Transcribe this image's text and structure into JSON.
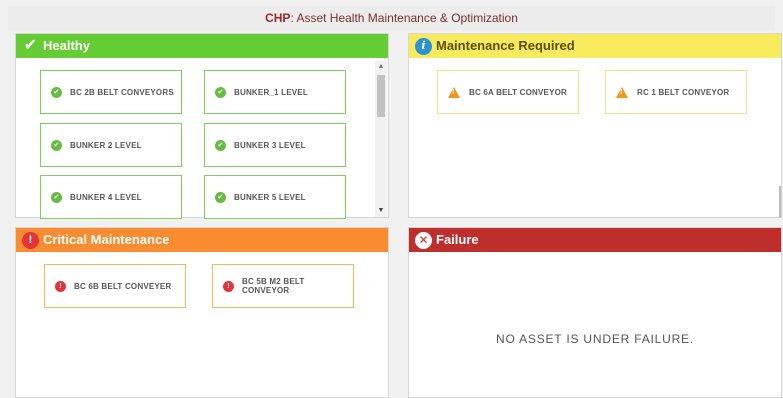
{
  "title": {
    "brand": "CHP",
    "text": ": Asset Health Maintenance & Optimization"
  },
  "panels": {
    "healthy": {
      "label": "Healthy",
      "color": "#66cc33",
      "assets": [
        "BC 2B BELT CONVEYORS",
        "BUNKER_1 LEVEL",
        "BUNKER 2 LEVEL",
        "BUNKER 3 LEVEL",
        "BUNKER 4 LEVEL",
        "BUNKER 5 LEVEL"
      ]
    },
    "maintenance": {
      "label": "Maintenance Required",
      "color": "#f7ea5c",
      "assets": [
        "BC 6A BELT CONVEYOR",
        "RC 1 BELT CONVEYOR"
      ]
    },
    "critical": {
      "label": "Critical Maintenance",
      "color": "#f98c31",
      "assets": [
        "BC 6B BELT CONVEYER",
        "BC 5B M2 BELT CONVEYOR"
      ]
    },
    "failure": {
      "label": "Failure",
      "color": "#bf2e2b",
      "empty_message": "NO ASSET IS UNDER FAILURE."
    }
  },
  "icons": {
    "healthy": "check-circle-icon",
    "maintenance": "info-circle-icon",
    "critical": "exclamation-circle-icon",
    "failure": "x-circle-icon",
    "asset_ok": "check-circle-icon",
    "asset_warn": "warning-triangle-icon",
    "asset_crit": "exclamation-circle-icon"
  }
}
